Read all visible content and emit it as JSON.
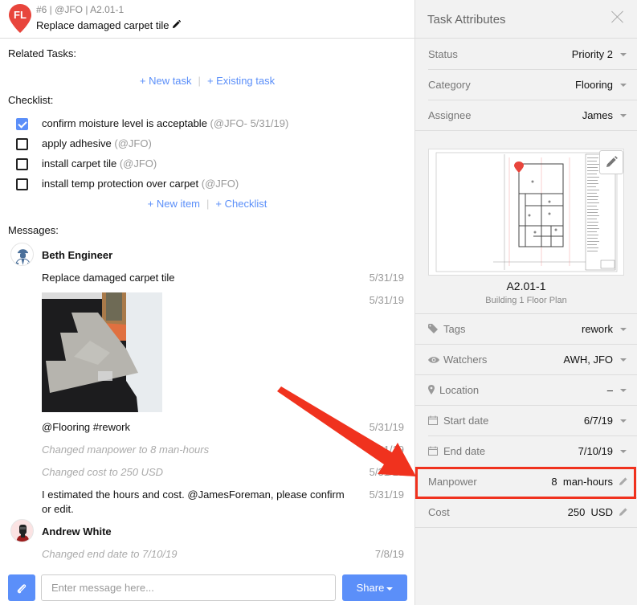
{
  "header": {
    "pin_initials": "FL",
    "pin_color": "#e8453c",
    "task_meta": "#6 | @JFO | A2.01-1",
    "task_title": "Replace damaged carpet tile"
  },
  "related_tasks": {
    "label": "Related Tasks:",
    "new_task": "+ New task",
    "existing_task": "+ Existing task",
    "separator": "|"
  },
  "checklist": {
    "label": "Checklist:",
    "items": [
      {
        "text": "confirm moisture level is acceptable",
        "meta": "(@JFO- 5/31/19)",
        "checked": true
      },
      {
        "text": "apply adhesive",
        "meta": "(@JFO)",
        "checked": false
      },
      {
        "text": "install carpet tile",
        "meta": "(@JFO)",
        "checked": false
      },
      {
        "text": "install temp protection over carpet",
        "meta": "(@JFO)",
        "checked": false
      }
    ],
    "new_item": "+ New item",
    "new_checklist": "+ Checklist",
    "separator": "|"
  },
  "messages": {
    "label": "Messages:",
    "threads": [
      {
        "author": "Beth Engineer",
        "entries": [
          {
            "text": "Replace damaged carpet tile",
            "date": "5/31/19",
            "type": "text"
          },
          {
            "text": "",
            "date": "5/31/19",
            "type": "photo"
          },
          {
            "text": "@Flooring #rework",
            "date": "5/31/19",
            "type": "text"
          },
          {
            "text": "Changed manpower to 8 man-hours",
            "date": "5/31/19",
            "type": "system"
          },
          {
            "text": "Changed cost to 250 USD",
            "date": "5/31/19",
            "type": "system"
          },
          {
            "text": "I estimated the hours and cost. @JamesForeman, please confirm or edit.",
            "date": "5/31/19",
            "type": "text"
          }
        ]
      },
      {
        "author": "Andrew White",
        "entries": [
          {
            "text": "Changed end date to 7/10/19",
            "date": "7/8/19",
            "type": "system"
          }
        ]
      }
    ]
  },
  "composer": {
    "placeholder": "Enter message here...",
    "value": "",
    "share_label": "Share"
  },
  "attributes_panel": {
    "title": "Task Attributes",
    "status": {
      "label": "Status",
      "value": "Priority 2"
    },
    "category": {
      "label": "Category",
      "value": "Flooring"
    },
    "assignee": {
      "label": "Assignee",
      "value": "James"
    },
    "plan": {
      "name": "A2.01-1",
      "description": "Building 1 Floor Plan"
    },
    "tags": {
      "label": "Tags",
      "value": "rework"
    },
    "watchers": {
      "label": "Watchers",
      "value": "AWH, JFO"
    },
    "location": {
      "label": "Location",
      "value": "–"
    },
    "start_date": {
      "label": "Start date",
      "value": "6/7/19"
    },
    "end_date": {
      "label": "End date",
      "value": "7/10/19"
    },
    "manpower": {
      "label": "Manpower",
      "value": "8",
      "unit": "man-hours"
    },
    "cost": {
      "label": "Cost",
      "value": "250",
      "unit": "USD"
    }
  },
  "annotation": {
    "color": "#f0321e"
  },
  "colors": {
    "accent": "#5b8ff9",
    "panel_bg": "#f2f2f2"
  }
}
